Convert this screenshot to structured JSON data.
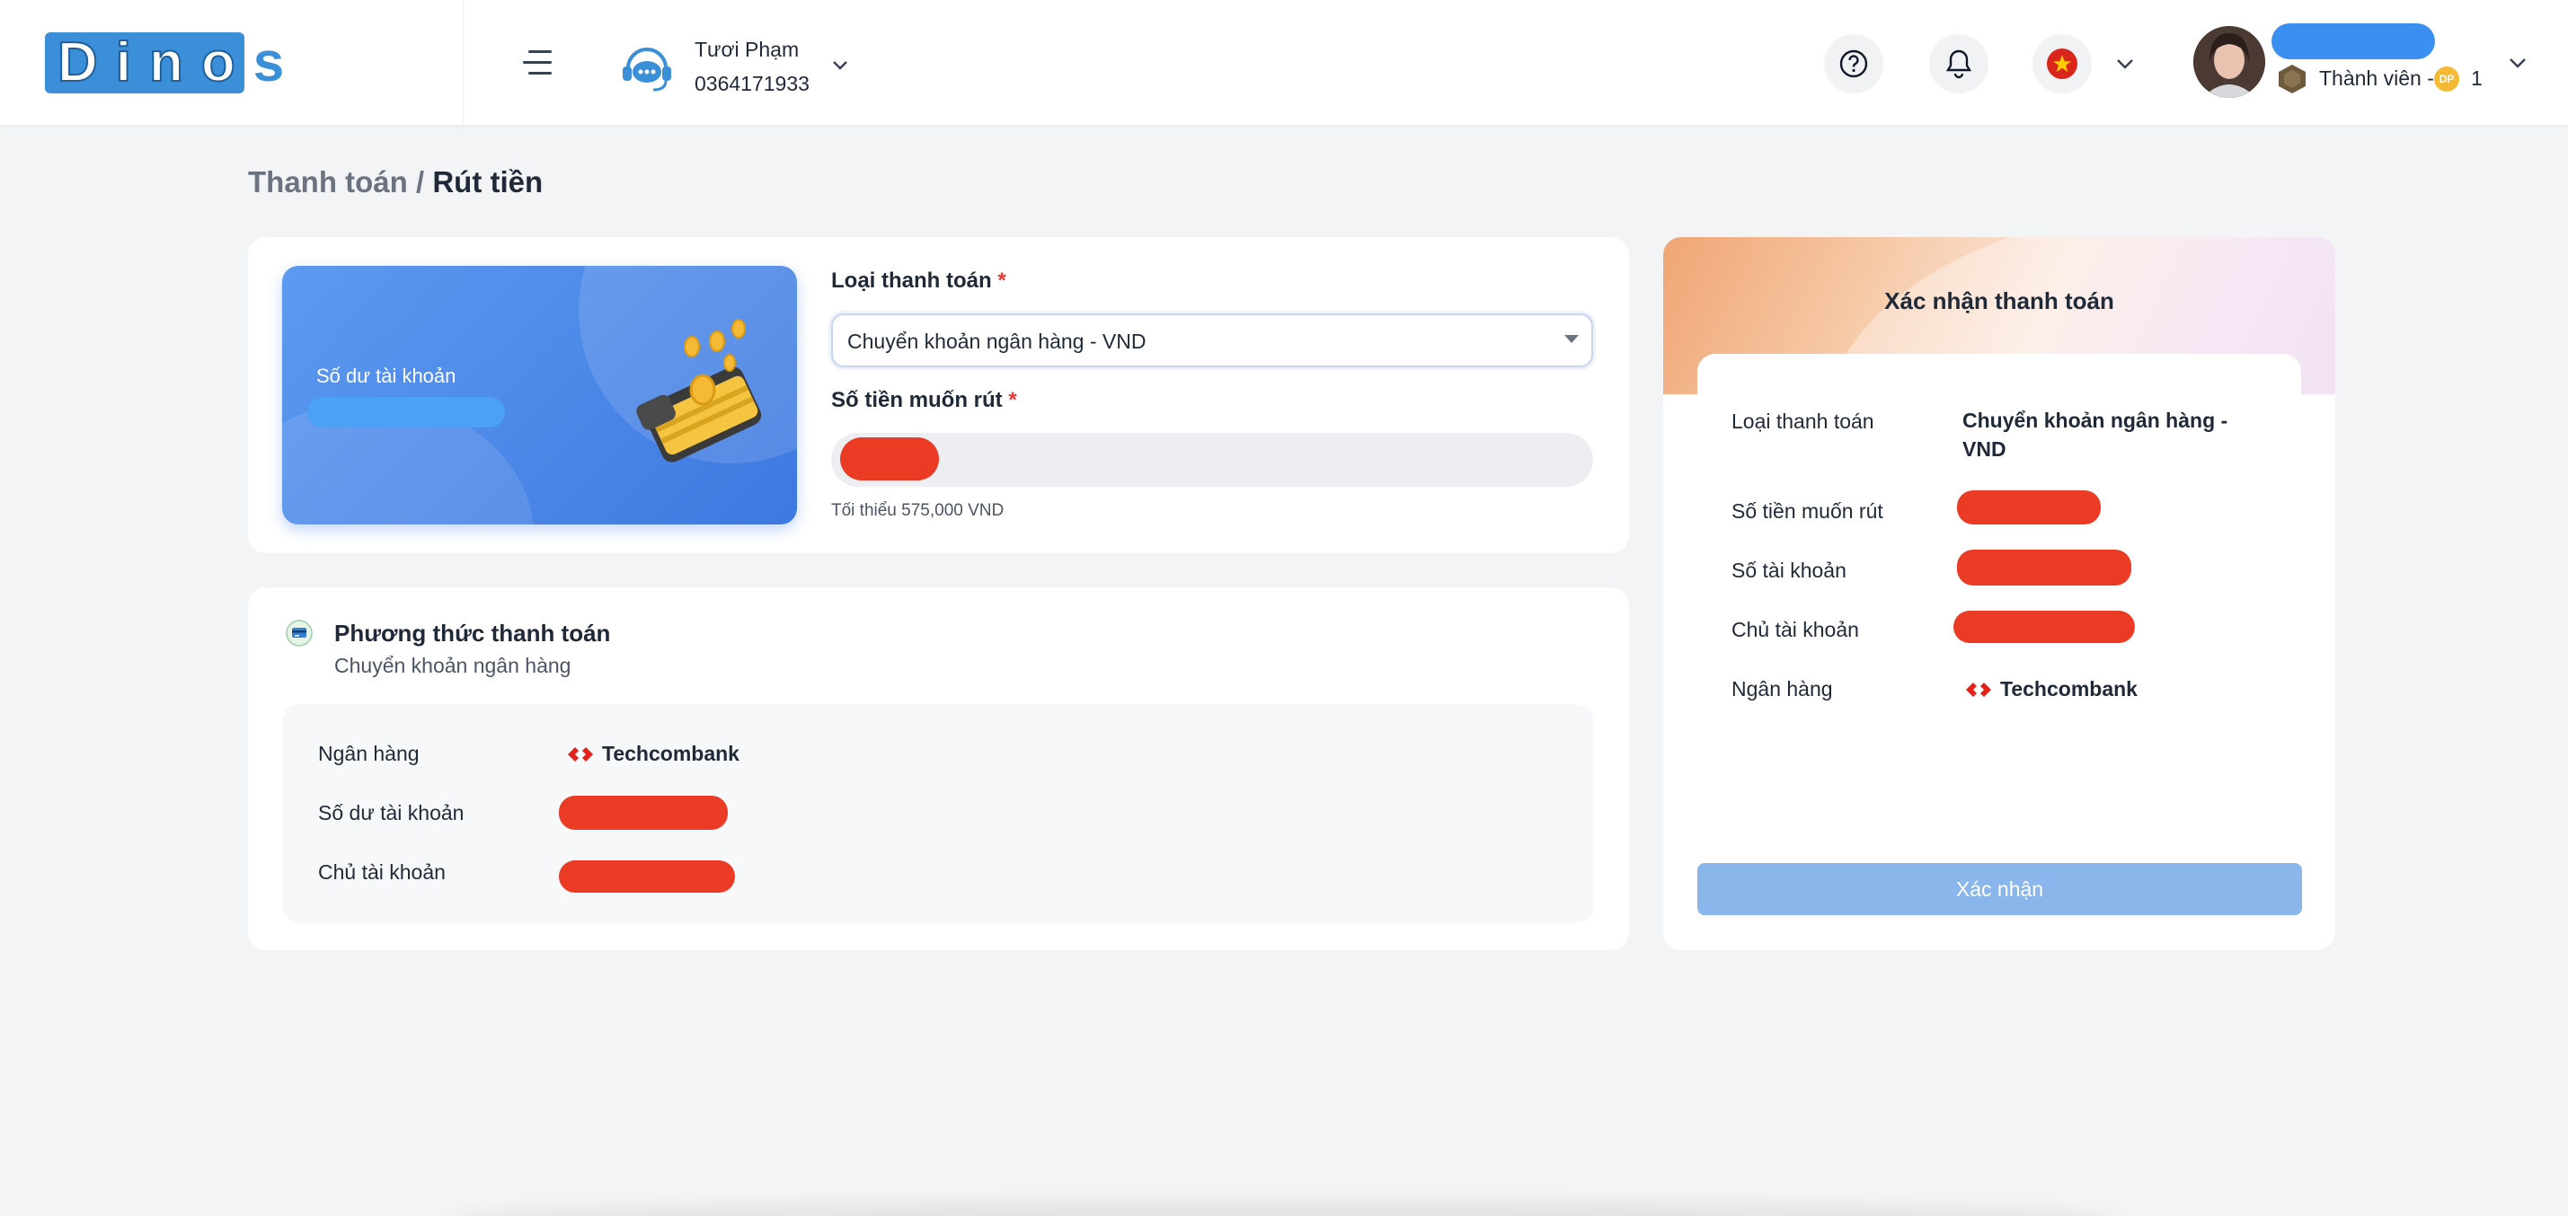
{
  "header": {
    "logo_text": "Dino",
    "logo_suffix": "s",
    "support": {
      "name": "Tươi Phạm",
      "phone": "0364171933"
    },
    "help_icon": "question-circle-icon",
    "notification_icon": "bell-icon",
    "language_flag": "vietnam-flag-icon",
    "user": {
      "rank_label": "Thành viên - ",
      "points_badge": "DP",
      "points": "1"
    }
  },
  "breadcrumb": {
    "parent": "Thanh toán",
    "separator": " / ",
    "current": "Rút tiền"
  },
  "balance_card": {
    "label": "Số dư tài khoản"
  },
  "withdraw_form": {
    "payment_type_label": "Loại thanh toán",
    "required_mark": "*",
    "payment_type_value": "Chuyển khoản ngân hàng - VND",
    "amount_label": "Số tiền muốn rút",
    "min_hint": "Tối thiểu 575,000 VND"
  },
  "payment_method": {
    "title": "Phương thức thanh toán",
    "subtitle": "Chuyển khoản ngân hàng",
    "rows": {
      "bank_label": "Ngân hàng",
      "bank_name": "Techcombank",
      "balance_label": "Số dư tài khoản",
      "owner_label": "Chủ tài khoản"
    }
  },
  "confirm": {
    "title": "Xác nhận thanh toán",
    "payment_type_label": "Loại thanh toán",
    "payment_type_value": "Chuyển khoản ngân hàng - VND",
    "amount_label": "Số tiền muốn rút",
    "account_number_label": "Số tài khoản",
    "owner_label": "Chủ tài khoản",
    "bank_label": "Ngân hàng",
    "bank_name": "Techcombank",
    "button": "Xác nhận"
  },
  "colors": {
    "accent_blue": "#3d78e0",
    "redaction_red": "#eb3b25",
    "confirm_button": "#8ab6ec"
  }
}
